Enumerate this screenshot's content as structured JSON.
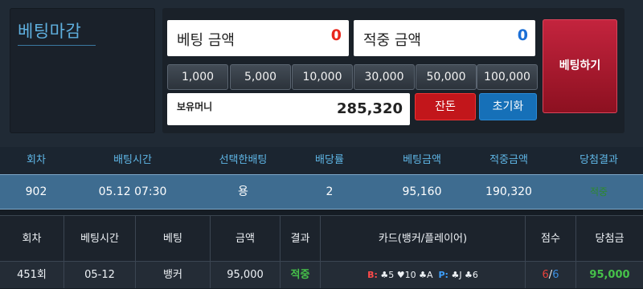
{
  "status": {
    "title": "베팅마감"
  },
  "bet": {
    "bet_amount_label": "베팅 금액",
    "bet_amount_value": "0",
    "win_amount_label": "적중 금액",
    "win_amount_value": "0",
    "chips": [
      "1,000",
      "5,000",
      "10,000",
      "30,000",
      "50,000",
      "100,000"
    ],
    "balance_label": "보유머니",
    "balance_value": "285,320",
    "change_label": "잔돈",
    "reset_label": "초기화",
    "bet_button_label": "베팅하기"
  },
  "history": {
    "headers": [
      "회차",
      "배팅시간",
      "선택한배팅",
      "배당률",
      "베팅금액",
      "적중금액",
      "당첨결과"
    ],
    "row": {
      "round": "902",
      "time": "05.12 07:30",
      "pick": "용",
      "odds": "2",
      "bet": "95,160",
      "win": "190,320",
      "result": "적중"
    }
  },
  "results": {
    "headers": [
      "회차",
      "베팅시간",
      "베팅",
      "금액",
      "결과",
      "카드(뱅커/플레이어)",
      "점수",
      "당첨금"
    ],
    "row": {
      "round": "451회",
      "time": "05-12",
      "bet": "뱅커",
      "amount": "95,000",
      "result": "적중",
      "banker_prefix": "B:",
      "banker_cards": "♣5 ♥10 ♣A",
      "player_prefix": "P:",
      "player_cards": "♣J ♣6",
      "score_banker": "6",
      "score_sep": "/",
      "score_player": "6",
      "payout": "95,000"
    }
  },
  "colors": {
    "accent": "#5fb0df",
    "bet_red": "#c4243e",
    "win_green": "#46c24a"
  }
}
